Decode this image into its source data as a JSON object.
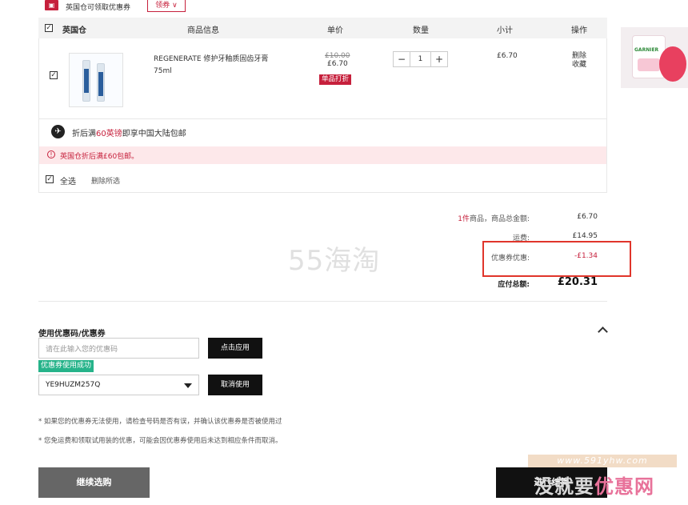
{
  "topbar": {
    "store_text": "英国仓可领取优惠券",
    "coupon_label": "领券 ∨"
  },
  "table": {
    "headers": [
      "英国仓",
      "商品信息",
      "单价",
      "数量",
      "小计",
      "操作"
    ],
    "item": {
      "name": "REGENERATE 修护牙釉质固齿牙膏 75ml",
      "old_price": "£10.00",
      "price": "£6.70",
      "badge": "单品打折",
      "qty": "1",
      "subtotal": "£6.70",
      "op_delete": "删除",
      "op_fav": "收藏"
    }
  },
  "shipping": {
    "pre": "折后满",
    "amount": "60英镑",
    "post": "即享中国大陆包邮"
  },
  "warning": "英国仓折后满£60包邮。",
  "select_all": "全选",
  "delete_selected": "删除所选",
  "summary": {
    "count": "1件",
    "count_label": "商品，商品总金额:",
    "goods_total": "£6.70",
    "freight_label": "运费:",
    "freight": "£14.95",
    "coupon_label": "优惠券优惠:",
    "coupon": "-£1.34",
    "total_label": "应付总额:",
    "total": "£20.31"
  },
  "watermark": "55海淘",
  "coupon": {
    "title": "使用优惠码/优惠券",
    "placeholder": "请在此输入您的优惠码",
    "apply": "点击应用",
    "success": "优惠券使用成功",
    "selected": "YE9HUZM257Q",
    "cancel": "取消使用"
  },
  "notes": [
    "* 如果您的优惠券无法使用，请检查号码是否有误，并确认该优惠券是否被使用过",
    "* 您免运费和领取试用装的优惠，可能会因优惠券使用后未达到相应条件而取消。"
  ],
  "buttons": {
    "continue": "继续选购",
    "checkout": "进行结算"
  },
  "watermark2": {
    "url": "www.591yhw.com",
    "text_a": "没就要",
    "text_b": "优惠网"
  },
  "ad_brand": "GARNIER"
}
